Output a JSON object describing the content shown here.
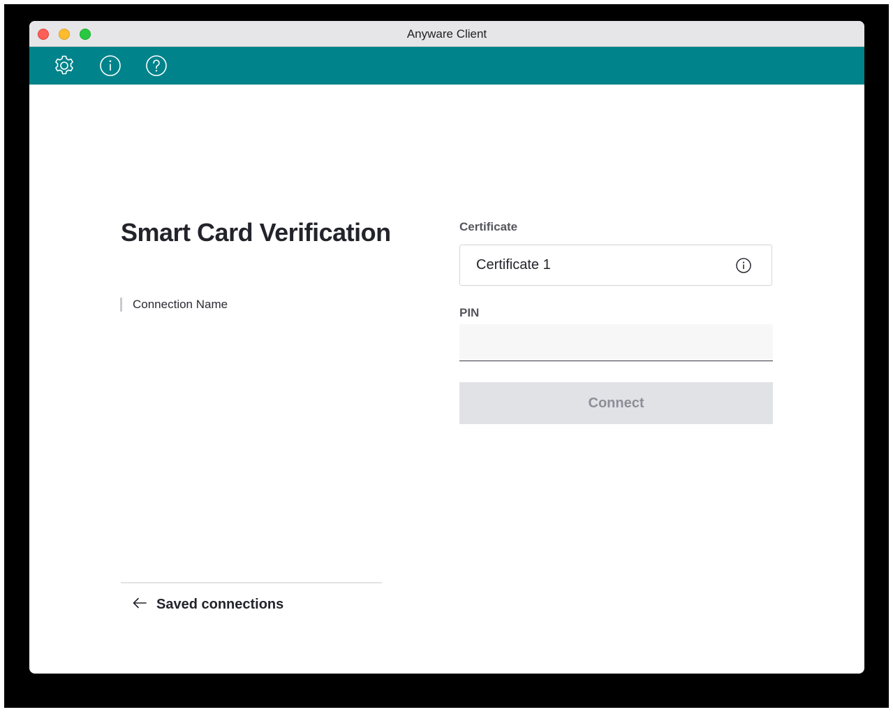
{
  "window": {
    "title": "Anyware Client"
  },
  "toolbar": {
    "icons": [
      "settings-icon",
      "info-icon",
      "help-icon"
    ],
    "background_color": "#00838a"
  },
  "main": {
    "heading": "Smart Card Verification",
    "connection_name": "Connection Name",
    "back_link_label": "Saved connections"
  },
  "form": {
    "certificate_label": "Certificate",
    "certificate_value": "Certificate 1",
    "pin_label": "PIN",
    "pin_value": "",
    "connect_label": "Connect"
  },
  "colors": {
    "accent": "#00838a",
    "button_disabled_bg": "#e1e2e6",
    "button_disabled_text": "#8e8e98"
  }
}
